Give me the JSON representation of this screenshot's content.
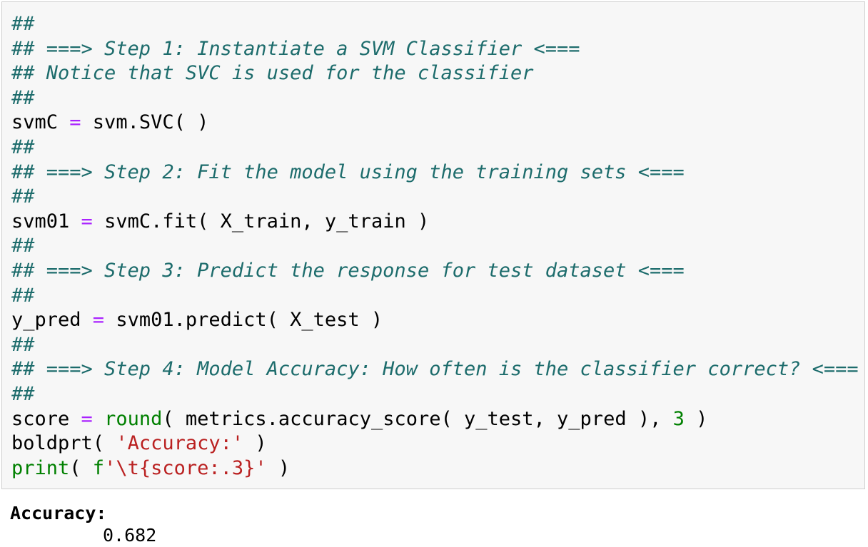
{
  "code_cell": {
    "lines": [
      "##",
      "## ===> Step 1: Instantiate a SVM Classifier <===",
      "## Notice that SVC is used for the classifier",
      "##",
      "svmC = svm.SVC( )",
      "##",
      "## ===> Step 2: Fit the model using the training sets <===",
      "##",
      "svm01 = svmC.fit( X_train, y_train )",
      "##",
      "## ===> Step 3: Predict the response for test dataset <===",
      "##",
      "y_pred = svm01.predict( X_test )",
      "##",
      "## ===> Step 4: Model Accuracy: How often is the classifier correct? <===",
      "##",
      "score = round( metrics.accuracy_score( y_test, y_pred ), 3 )",
      "boldprt( 'Accuracy:' )",
      "print( f'\\t{score:.3}' )"
    ]
  },
  "output": {
    "label": "Accuracy:",
    "value": "0.682"
  },
  "colors": {
    "comment": "#1d6c6c",
    "builtin": "#008000",
    "operator": "#aa22ff",
    "string": "#ba2121",
    "cell_background": "#f7f7f7"
  }
}
